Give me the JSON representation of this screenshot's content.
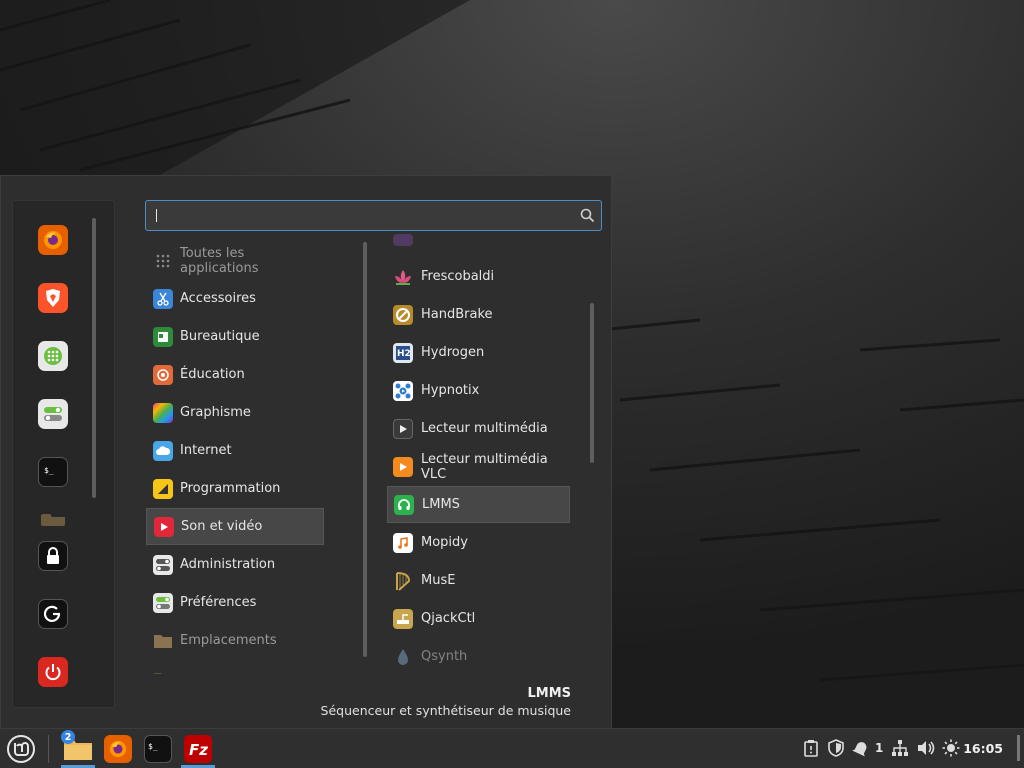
{
  "search": {
    "value": "",
    "placeholder": ""
  },
  "favorites": [
    {
      "name": "firefox"
    },
    {
      "name": "brave"
    },
    {
      "name": "software-manager"
    },
    {
      "name": "settings"
    },
    {
      "name": "terminal"
    },
    {
      "name": "files"
    }
  ],
  "session": [
    "lock",
    "logout",
    "shutdown"
  ],
  "categories": [
    {
      "label": "Toutes les applications",
      "icon": "grid-icon"
    },
    {
      "label": "Accessoires",
      "icon": "scissors-icon"
    },
    {
      "label": "Bureautique",
      "icon": "office-icon"
    },
    {
      "label": "Éducation",
      "icon": "education-icon"
    },
    {
      "label": "Graphisme",
      "icon": "graphics-icon"
    },
    {
      "label": "Internet",
      "icon": "cloud-icon"
    },
    {
      "label": "Programmation",
      "icon": "programming-icon"
    },
    {
      "label": "Son et vidéo",
      "icon": "play-icon"
    },
    {
      "label": "Administration",
      "icon": "admin-icon"
    },
    {
      "label": "Préférences",
      "icon": "preferences-icon"
    },
    {
      "label": "Emplacements",
      "icon": "folder-icon"
    }
  ],
  "apps": [
    {
      "label": "Frescobaldi",
      "icon": "lotus-icon"
    },
    {
      "label": "HandBrake",
      "icon": "handbrake-icon"
    },
    {
      "label": "Hydrogen",
      "icon": "hydrogen-icon"
    },
    {
      "label": "Hypnotix",
      "icon": "hypnotix-icon"
    },
    {
      "label": "Lecteur multimédia",
      "icon": "media-player-icon"
    },
    {
      "label": "Lecteur multimédia VLC",
      "icon": "vlc-icon"
    },
    {
      "label": "LMMS",
      "icon": "lmms-icon"
    },
    {
      "label": "Mopidy",
      "icon": "music-note-icon"
    },
    {
      "label": "MusE",
      "icon": "harp-icon"
    },
    {
      "label": "QjackCtl",
      "icon": "jack-icon"
    },
    {
      "label": "Qsynth",
      "icon": "qsynth-icon"
    }
  ],
  "selected_category": "Son et vidéo",
  "selected_app": "LMMS",
  "description": {
    "title": "LMMS",
    "text": "Séquenceur et synthétiseur de musique"
  },
  "taskbar": {
    "badge_count": "2",
    "tray_count": "1",
    "clock": "16:05"
  },
  "colors": {
    "accent": "#3584e4",
    "firefox": "#e66000",
    "selected_bg": "#474747",
    "search_border": "#4d8fc4"
  }
}
